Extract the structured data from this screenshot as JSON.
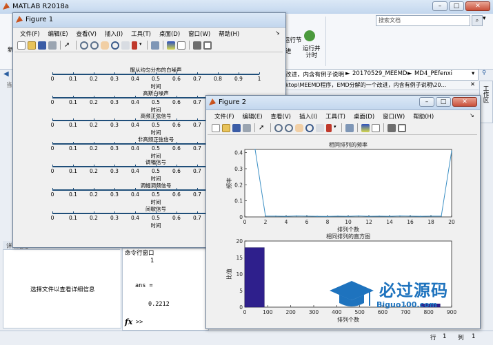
{
  "matlab": {
    "title": "MATLAB R2018a",
    "search_placeholder": "搜索文档",
    "ribbon_run_section": "运行节",
    "ribbon_advance": "进",
    "ribbon_run_time": "运行并\n计时",
    "ribbon_new": "新",
    "path_text": "改进，内含有例子说明",
    "path_crumb_1": "20170529_MEEMD",
    "path_crumb_2": "MD4_PEfenxi",
    "path_full": "ktop\\MEEMD程序，EMD分解的一个改进，内含有例子说明\\20...",
    "workspace_label": "工作区",
    "left_tab_label": "当",
    "detail_label": "详细信息",
    "detail_message": "选择文件以查看详细信息",
    "cmd_window_title": "命令行窗口",
    "cmd_lines": [
      "1",
      "",
      "ans =",
      "",
      "0.2212"
    ],
    "cmd_prompt": ">>",
    "fx_label": "fx",
    "status_row_label": "行",
    "status_row": "1",
    "status_col_label": "列",
    "status_col": "1"
  },
  "figure1": {
    "title": "Figure 1",
    "menu": [
      "文件(F)",
      "编辑(E)",
      "查看(V)",
      "插入(I)",
      "工具(T)",
      "桌面(D)",
      "窗口(W)",
      "帮助(H)"
    ],
    "plots": [
      {
        "title": "服从均匀分布的白噪声",
        "xlabel": "时间"
      },
      {
        "title": "高斯白噪声",
        "xlabel": "时间"
      },
      {
        "title": "高频正弦信号",
        "xlabel": "时间"
      },
      {
        "title": "非高频正弦信号",
        "xlabel": "时间"
      },
      {
        "title": "调幅信号",
        "xlabel": "时间"
      },
      {
        "title": "调幅调频信号",
        "xlabel": "时间"
      },
      {
        "title": "间歇信号",
        "xlabel": "时间"
      }
    ],
    "ticks": [
      "0",
      "0.1",
      "0.2",
      "0.3",
      "0.4",
      "0.5",
      "0.6",
      "0.7",
      "0.8",
      "0.9",
      "1"
    ]
  },
  "figure2": {
    "title": "Figure 2",
    "menu": [
      "文件(F)",
      "编辑(E)",
      "查看(V)",
      "插入(I)",
      "工具(T)",
      "桌面(D)",
      "窗口(W)",
      "帮助(H)"
    ]
  },
  "chart_data": [
    {
      "type": "line",
      "title": "相同排列的频率",
      "xlabel": "排列个数",
      "ylabel": "频率",
      "xlim": [
        0,
        20
      ],
      "ylim": [
        0,
        0.42
      ],
      "xticks": [
        "0",
        "2",
        "4",
        "6",
        "8",
        "10",
        "12",
        "14",
        "16",
        "18",
        "20"
      ],
      "yticks": [
        "0",
        "0.1",
        "0.2",
        "0.3",
        "0.4"
      ],
      "x": [
        1,
        2,
        3,
        4,
        5,
        6,
        7,
        8,
        9,
        10,
        11,
        12,
        13,
        14,
        15,
        16,
        17,
        18,
        19,
        20
      ],
      "series": [
        {
          "values": [
            0.42,
            0.005,
            0.005,
            0.004,
            0.006,
            0.005,
            0.004,
            0.003,
            0.005,
            0.004,
            0.006,
            0.004,
            0.005,
            0.004,
            0.006,
            0.005,
            0.004,
            0.005,
            0.005,
            0.41
          ]
        }
      ],
      "color": "#3b8fc4"
    },
    {
      "type": "bar",
      "title": "相同排列的直方图",
      "xlabel": "排列个数",
      "ylabel": "比值",
      "xlim": [
        0,
        900
      ],
      "ylim": [
        0,
        20
      ],
      "xticks": [
        "0",
        "100",
        "200",
        "300",
        "400",
        "500",
        "600",
        "700",
        "800",
        "900"
      ],
      "yticks": [
        "0",
        "5",
        "10",
        "15",
        "20"
      ],
      "bins": [
        {
          "start": 0,
          "end": 85,
          "value": 18
        },
        {
          "start": 765,
          "end": 850,
          "value": 1
        }
      ],
      "color": "#2e1f8c"
    }
  ],
  "watermark": {
    "text": "必过源码",
    "url": "Biguo100.com"
  }
}
